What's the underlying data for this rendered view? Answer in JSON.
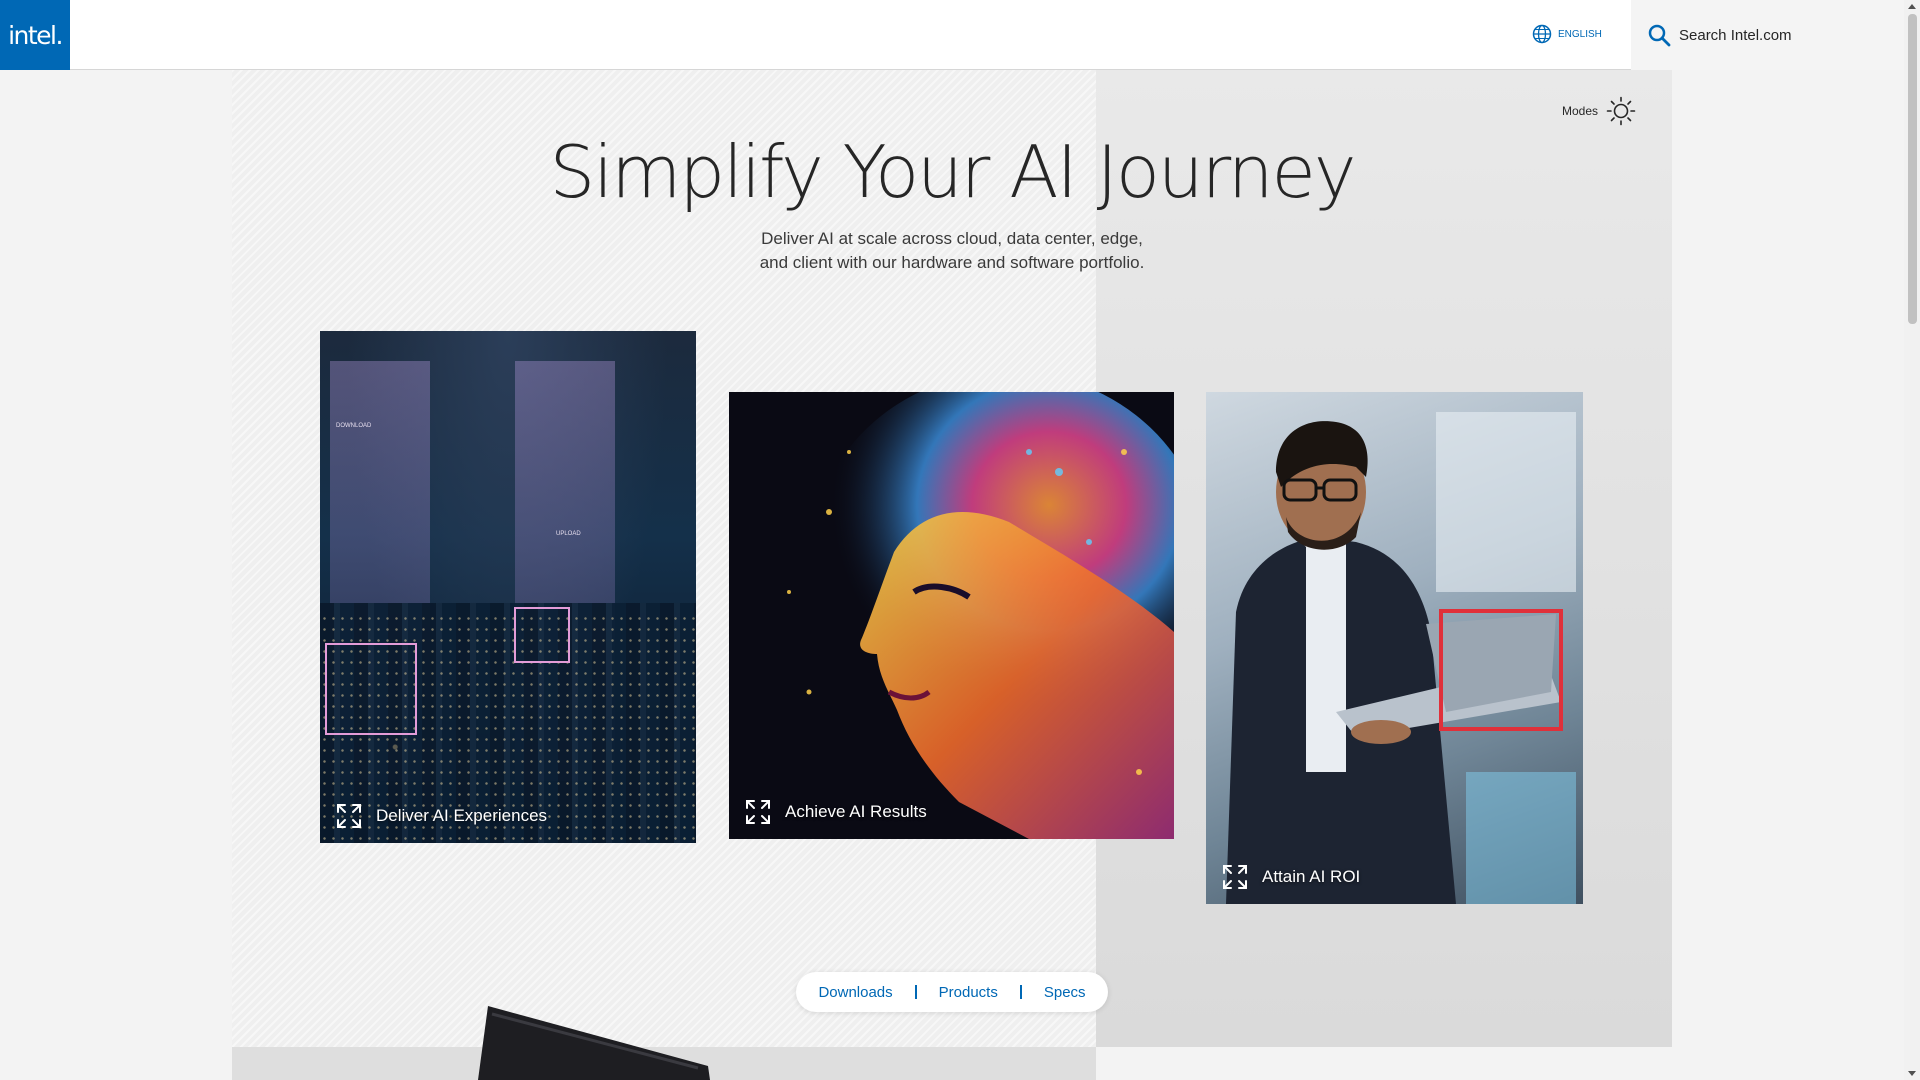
{
  "header": {
    "logo_text": "intel.",
    "language_label": "ENGLISH",
    "search_placeholder": "Search Intel.com"
  },
  "hero": {
    "modes_label": "Modes",
    "title": "Simplify Your AI Journey",
    "subtitle": "Deliver AI at scale across cloud, data center, edge, and client with our hardware and software portfolio."
  },
  "cards": [
    {
      "label": "Deliver AI Experiences",
      "overlay_text_1": "DOWNLOAD",
      "overlay_text_2": "UPLOAD"
    },
    {
      "label": "Achieve AI Results"
    },
    {
      "label": "Attain AI ROI"
    }
  ],
  "pill_nav": {
    "items": [
      "Downloads",
      "Products",
      "Specs"
    ]
  },
  "colors": {
    "brand": "#0068b5",
    "accent_frame": "#e49cd8",
    "red_frame": "#e0303a"
  }
}
